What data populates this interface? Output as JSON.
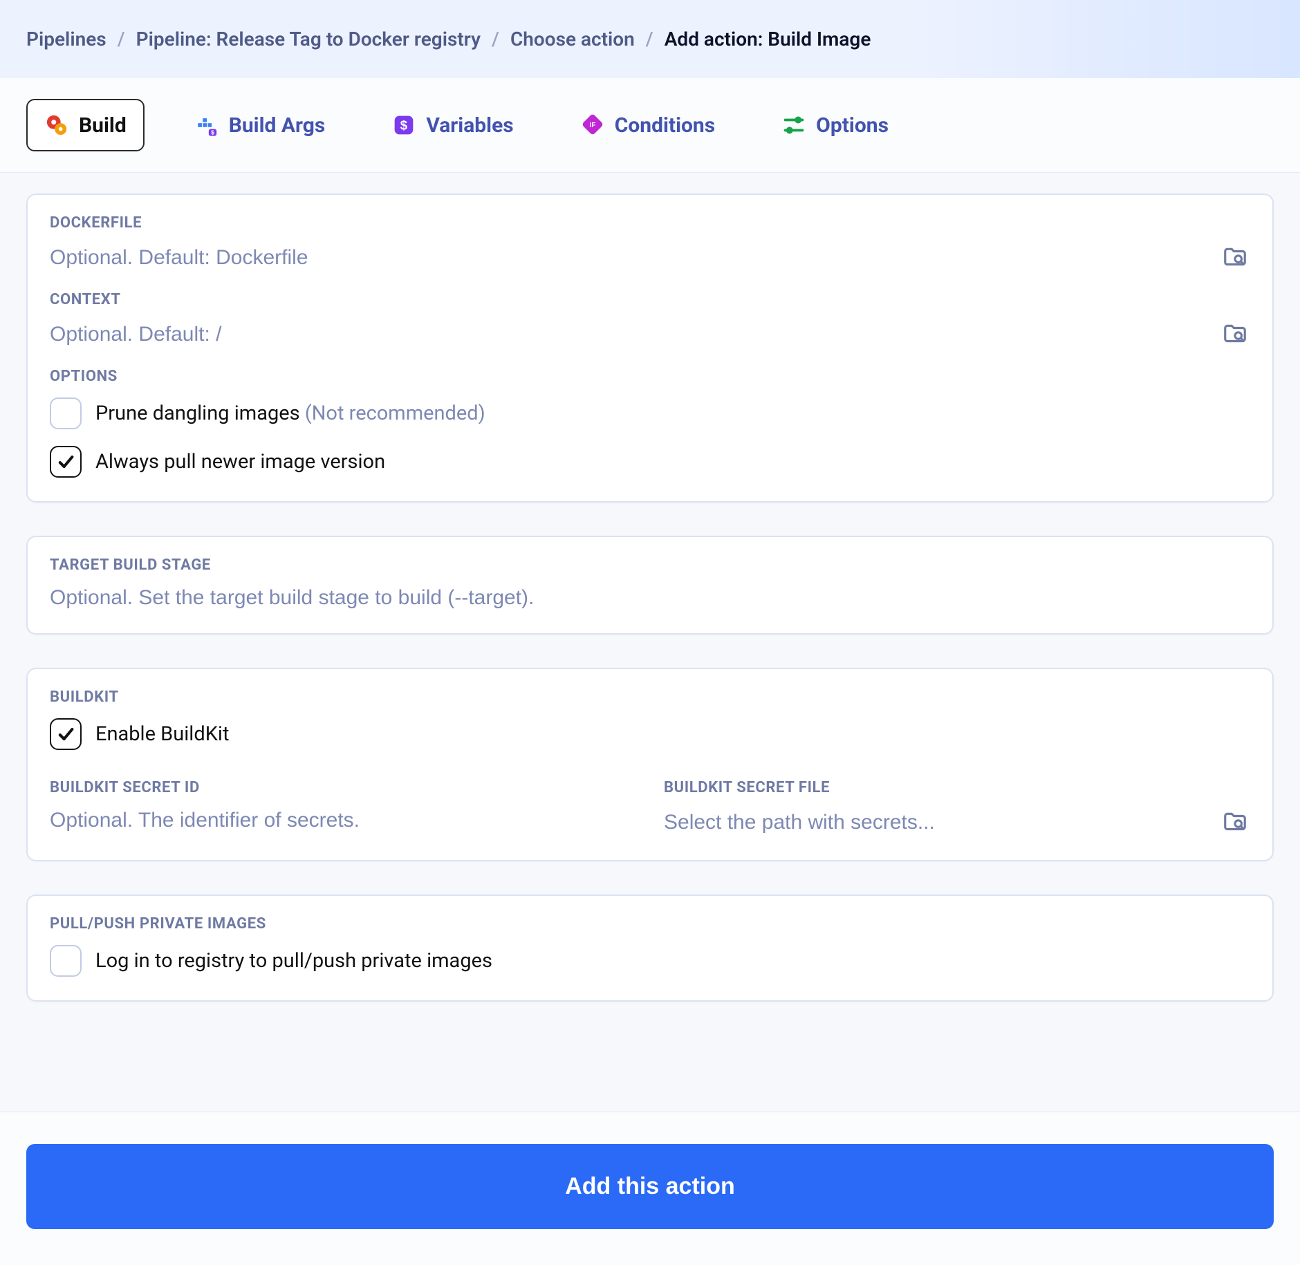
{
  "breadcrumbs": {
    "items": [
      {
        "label": "Pipelines",
        "current": false
      },
      {
        "label": "Pipeline: Release Tag to Docker registry",
        "current": false
      },
      {
        "label": "Choose action",
        "current": false
      },
      {
        "label": "Add action: Build Image",
        "current": true
      }
    ],
    "separator": "/"
  },
  "tabs": [
    {
      "label": "Build",
      "active": true,
      "icon": "gear-orange-icon"
    },
    {
      "label": "Build Args",
      "active": false,
      "icon": "docker-icon"
    },
    {
      "label": "Variables",
      "active": false,
      "icon": "dollar-tile-icon"
    },
    {
      "label": "Conditions",
      "active": false,
      "icon": "diamond-if-icon"
    },
    {
      "label": "Options",
      "active": false,
      "icon": "sliders-icon"
    }
  ],
  "sections": {
    "dockerfile": {
      "label": "DOCKERFILE",
      "placeholder": "Optional. Default: Dockerfile",
      "value": ""
    },
    "context": {
      "label": "CONTEXT",
      "placeholder": "Optional. Default: /",
      "value": ""
    },
    "options": {
      "label": "OPTIONS",
      "prune": {
        "text": "Prune dangling images ",
        "note": "(Not recommended)",
        "checked": false
      },
      "pull_newer": {
        "text": "Always pull newer image version",
        "checked": true
      }
    },
    "target_stage": {
      "label": "TARGET BUILD STAGE",
      "placeholder": "Optional. Set the target build stage to build (--target).",
      "value": ""
    },
    "buildkit": {
      "label": "BUILDKIT",
      "enable": {
        "text": "Enable BuildKit",
        "checked": true
      },
      "secret_id": {
        "label": "BUILDKIT SECRET ID",
        "placeholder": "Optional. The identifier of secrets.",
        "value": ""
      },
      "secret_file": {
        "label": "BUILDKIT SECRET FILE",
        "placeholder": "Select the path with secrets...",
        "value": ""
      }
    },
    "private_images": {
      "label": "PULL/PUSH PRIVATE IMAGES",
      "login": {
        "text": "Log in to registry to pull/push private images",
        "checked": false
      }
    }
  },
  "footer": {
    "primary_label": "Add this action"
  },
  "icons": {
    "browse": "folder-search-icon"
  }
}
